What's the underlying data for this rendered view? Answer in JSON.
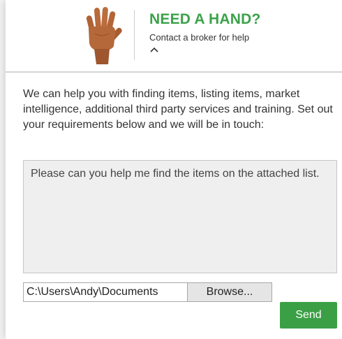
{
  "header": {
    "title": "NEED A HAND?",
    "subtitle": "Contact a broker for help",
    "icon": "raised-hand-icon",
    "toggle_icon": "chevron-up-icon",
    "title_color": "#3ca24a"
  },
  "main": {
    "description": "We can help you with finding items, listing items, market intelligence, additional third party services and training. Set out your requirements below and we will be in touch:",
    "message_value": "Please can you help me find the items on the attached list.",
    "file_path_value": "C:\\Users\\Andy\\Documents",
    "browse_label": "Browse...",
    "send_label": "Send",
    "accent_color": "#3ba045"
  }
}
